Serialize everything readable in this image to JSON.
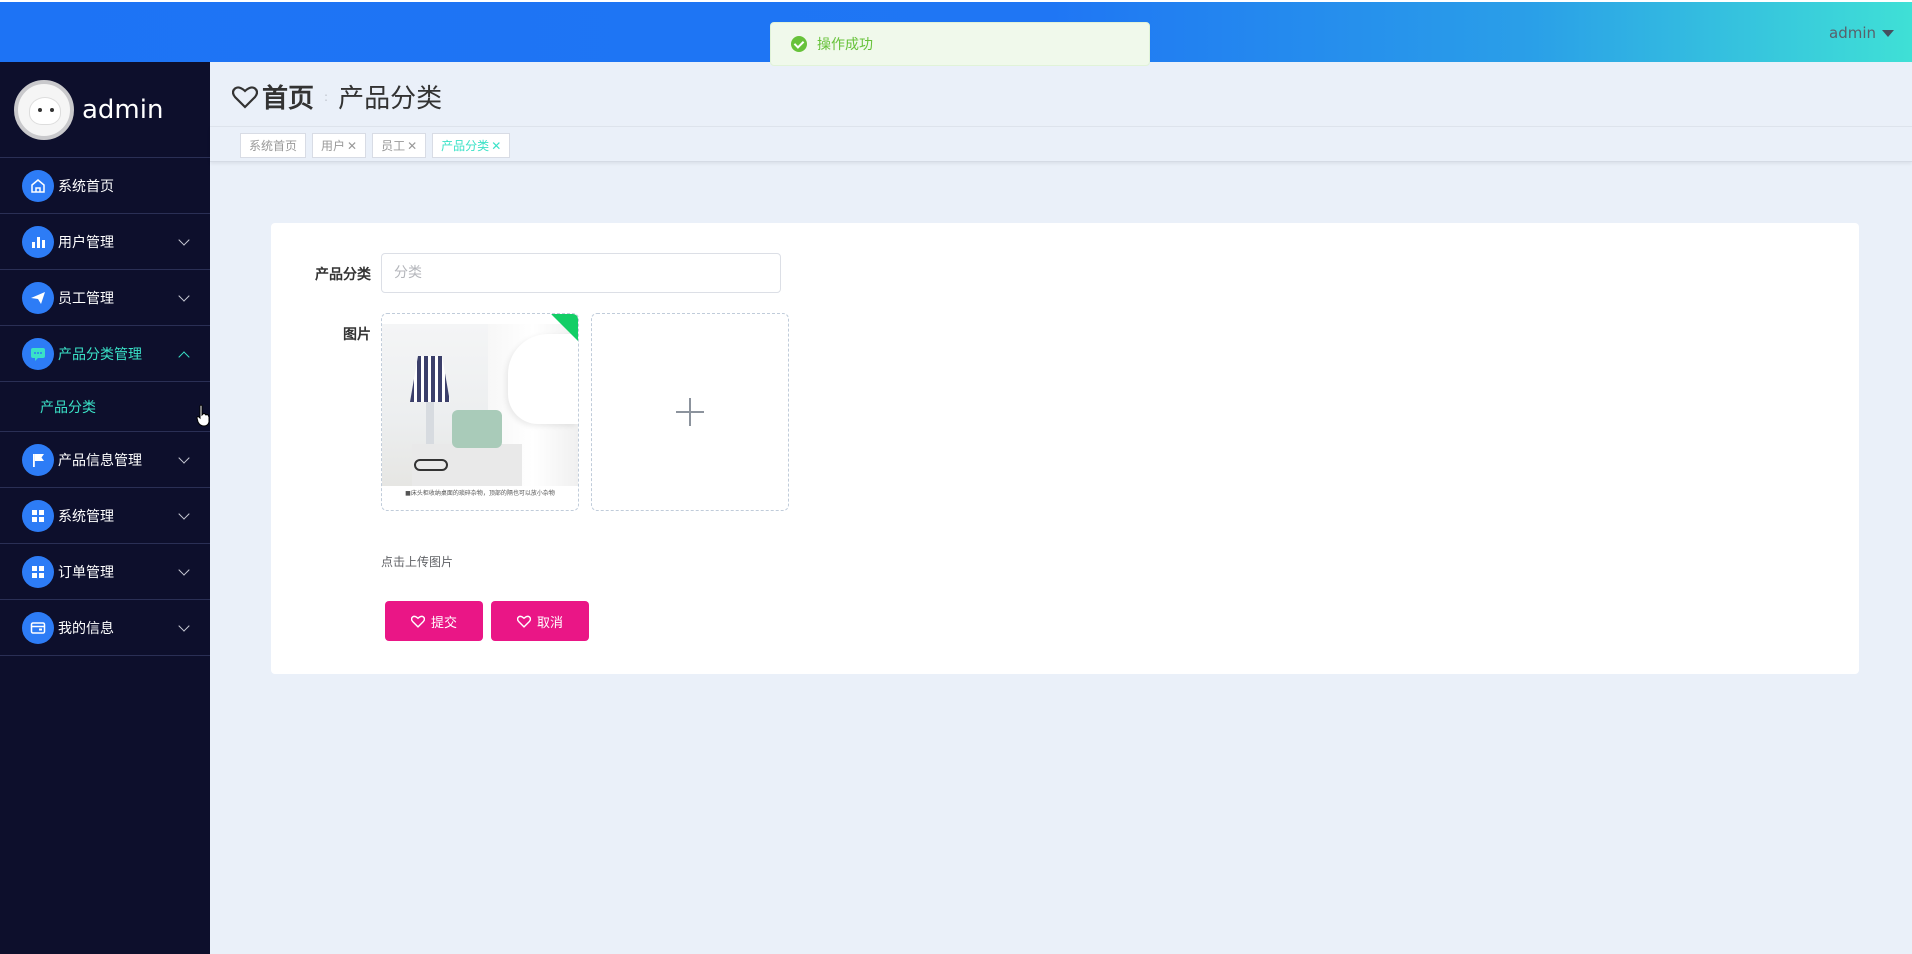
{
  "header": {
    "user_label": "admin"
  },
  "toast": {
    "message": "操作成功"
  },
  "sidebar": {
    "username": "admin",
    "items": [
      {
        "label": "系统首页",
        "icon": "home-icon"
      },
      {
        "label": "用户管理",
        "icon": "bar-chart-icon"
      },
      {
        "label": "员工管理",
        "icon": "paper-plane-icon"
      },
      {
        "label": "产品分类管理",
        "icon": "chat-icon"
      },
      {
        "label": "产品信息管理",
        "icon": "flag-icon"
      },
      {
        "label": "系统管理",
        "icon": "grid-icon"
      },
      {
        "label": "订单管理",
        "icon": "grid-icon"
      },
      {
        "label": "我的信息",
        "icon": "wallet-icon"
      }
    ],
    "sub_item": "产品分类"
  },
  "breadcrumb": {
    "home": "首页",
    "separator": ":",
    "current": "产品分类"
  },
  "tags": [
    {
      "label": "系统首页"
    },
    {
      "label": "用户",
      "close": "✕"
    },
    {
      "label": "员工",
      "close": "✕"
    },
    {
      "label": "产品分类",
      "close": "✕"
    }
  ],
  "form": {
    "category_label": "产品分类",
    "category_placeholder": "分类",
    "image_label": "图片",
    "image_caption": "■床头柜收纳桌面的琐碎杂物，顶部的隔也可以放小杂物",
    "upload_hint": "点击上传图片",
    "submit_label": "提交",
    "cancel_label": "取消"
  },
  "colors": {
    "header_gradient_start": "#1d73f5",
    "header_gradient_end": "#3fe0d6",
    "sidebar_bg": "#0d0f2c",
    "active_accent": "#3ae2c7",
    "button": "#ea1686",
    "success": "#67c23a"
  }
}
